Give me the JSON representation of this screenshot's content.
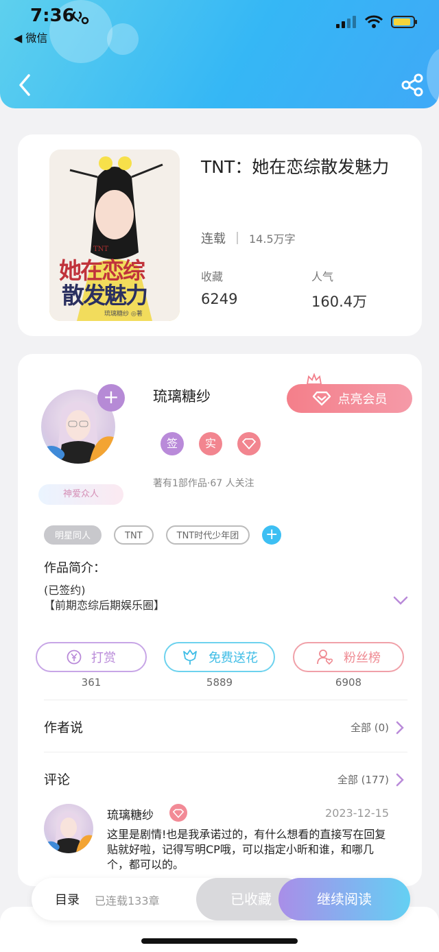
{
  "status_bar": {
    "time": "7:36",
    "back_app": "◀ 微信"
  },
  "book": {
    "title": "TNT：她在恋综散发魅力",
    "status": "连载",
    "word_count": "14.5万字",
    "stats": [
      {
        "label": "收藏",
        "value": "6249"
      },
      {
        "label": "人气",
        "value": "160.4万"
      }
    ],
    "cover_text": {
      "line1": "她在恋综",
      "line2": "散发魅力",
      "small": "TNT",
      "author_small": "琉璃糖纱 ◎著"
    }
  },
  "author": {
    "name": "琉璃糖纱",
    "vip_button": "点亮会员",
    "badges": [
      {
        "label": "签",
        "color": "#b98ad9"
      },
      {
        "label": "实",
        "color": "#f2858f"
      },
      {
        "label": "",
        "color": "#f2858f"
      }
    ],
    "works_info": "著有1部作品·67 人关注",
    "title_tag": "神爱众人"
  },
  "tags": [
    "明星同人",
    "TNT",
    "TNT时代少年团"
  ],
  "intro": {
    "label": "作品简介：",
    "line1": "(已签约)",
    "line2": "【前期恋综后期娱乐圈】"
  },
  "actions": [
    {
      "label": "打赏",
      "count": "361",
      "color": "#b98ad9"
    },
    {
      "label": "免费送花",
      "count": "5889",
      "color": "#43c6ea"
    },
    {
      "label": "粉丝榜",
      "count": "6908",
      "color": "#ef8a92"
    }
  ],
  "author_says": {
    "title": "作者说",
    "link": "全部 (0)"
  },
  "comments": {
    "title": "评论",
    "link": "全部 (177)",
    "first": {
      "user": "琉璃糖纱",
      "date": "2023-12-15",
      "text": "这里是剧情!也是我承诺过的，有什么想看的直接写在回复贴就好啦，记得写明CP哦，可以指定小昕和谁，和哪几个，都可以的。"
    }
  },
  "bottom_bar": {
    "toc": "目录",
    "serial_info": "已连载133章",
    "collected": "已收藏",
    "continue": "继续阅读"
  },
  "colors": {
    "header": "#3fb4f5",
    "accent_purple": "#b98ad9",
    "accent_pink": "#ef8a92",
    "accent_blue": "#43c6ea"
  }
}
